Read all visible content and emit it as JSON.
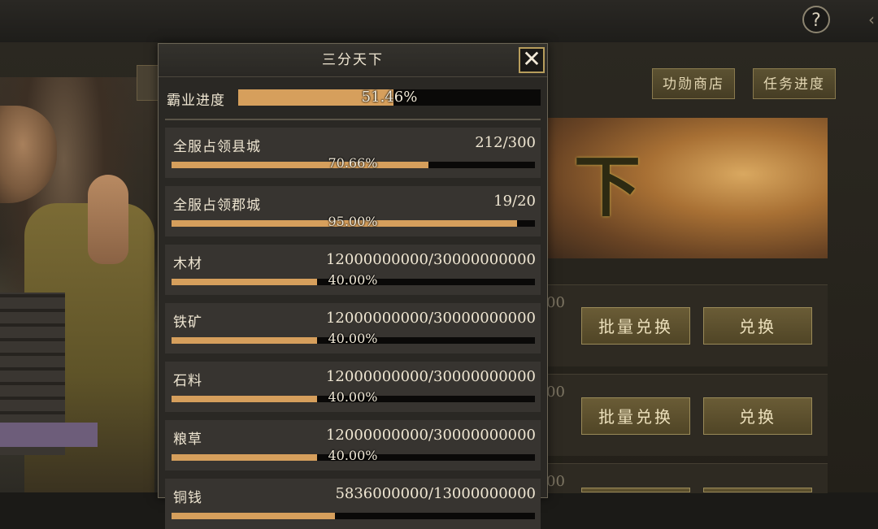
{
  "modal": {
    "title": "三分天下",
    "close_icon": "close-icon",
    "overall": {
      "label": "霸业进度",
      "percent_text": "51.46%",
      "fraction": 0.5146
    },
    "items": [
      {
        "label": "全服占领县城",
        "value": "212/300",
        "percent_text": "70.66%",
        "fraction": 0.7066
      },
      {
        "label": "全服占领郡城",
        "value": "19/20",
        "percent_text": "95.00%",
        "fraction": 0.95
      },
      {
        "label": "木材",
        "value": "12000000000/30000000000",
        "percent_text": "40.00%",
        "fraction": 0.4
      },
      {
        "label": "铁矿",
        "value": "12000000000/30000000000",
        "percent_text": "40.00%",
        "fraction": 0.4
      },
      {
        "label": "石料",
        "value": "12000000000/30000000000",
        "percent_text": "40.00%",
        "fraction": 0.4
      },
      {
        "label": "粮草",
        "value": "12000000000/30000000000",
        "percent_text": "40.00%",
        "fraction": 0.4
      },
      {
        "label": "铜钱",
        "value": "5836000000/13000000000",
        "percent_text": "",
        "fraction": 0.449
      }
    ]
  },
  "background": {
    "help_label": "?",
    "shop_button": "功勋商店",
    "task_button": "任务进度",
    "banner_text": "下",
    "row_partial_values": [
      "00",
      "00",
      "00"
    ],
    "batch_exchange": "批量兑换",
    "exchange": "兑换"
  },
  "colors": {
    "progress_fill": "#d69f5c",
    "progress_track": "#0a0908",
    "accent_border": "#b79d5c"
  }
}
